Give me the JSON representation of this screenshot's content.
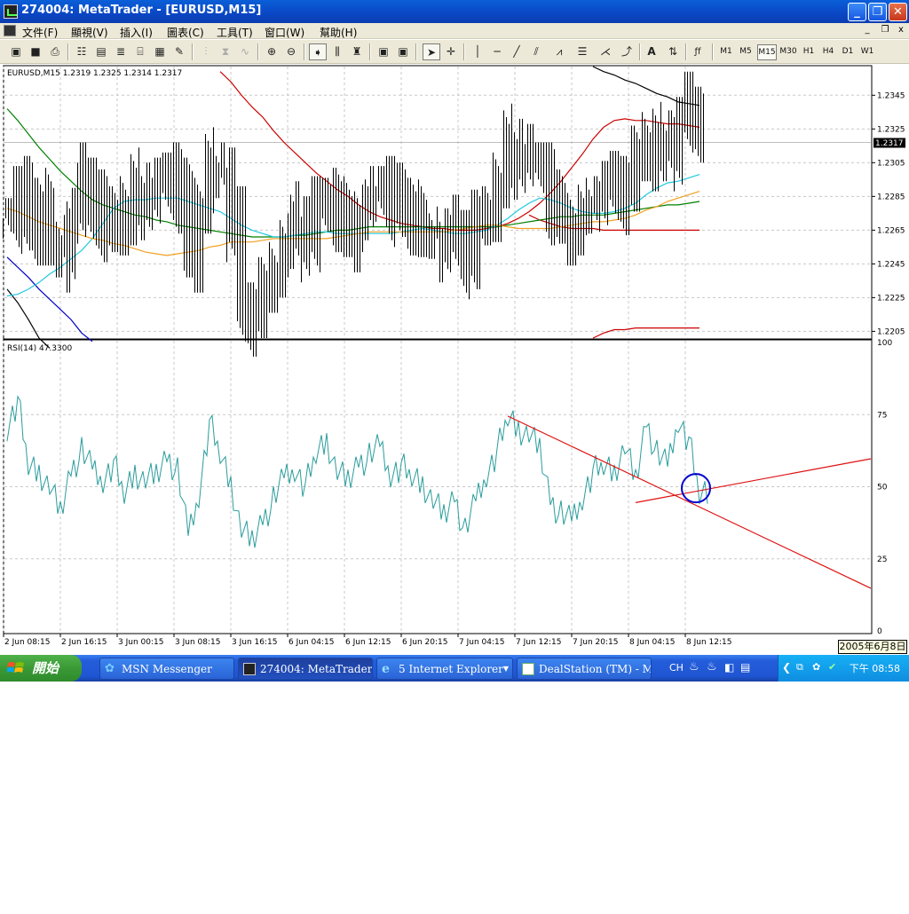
{
  "window": {
    "title": "274004: MetaTrader - [EURUSD,M15]",
    "minimize_glyph": "_",
    "restore_glyph": "❐",
    "close_glyph": "✕"
  },
  "menu": {
    "items": [
      "文件(F)",
      "顯視(V)",
      "插入(I)",
      "圖表(C)",
      "工具(T)",
      "窗口(W)",
      "幫助(H)"
    ],
    "mdi_min": "_",
    "mdi_restore": "❐",
    "mdi_close": "x"
  },
  "toolbar": {
    "timeframes": [
      "M1",
      "M5",
      "M15",
      "M30",
      "H1",
      "H4",
      "D1",
      "W1"
    ],
    "active_timeframe": "M15",
    "text_tool": "A",
    "fib_tool": "ƒf"
  },
  "chart_data": {
    "type": "line",
    "symbol_label": "EURUSD,M15  1.2319 1.2325 1.2314 1.2317",
    "price_ticks": [
      "1.2345",
      "1.2325",
      "1.2305",
      "1.2285",
      "1.2265",
      "1.2245",
      "1.2225",
      "1.2205"
    ],
    "price_range": [
      1.2201,
      1.2362
    ],
    "current_price": "1.2317",
    "time_ticks": [
      "2 Jun 08:15",
      "2 Jun 16:15",
      "3 Jun 00:15",
      "3 Jun 08:15",
      "3 Jun 16:15",
      "6 Jun 04:15",
      "6 Jun 12:15",
      "6 Jun 20:15",
      "7 Jun 04:15",
      "7 Jun 12:15",
      "7 Jun 20:15",
      "8 Jun 04:15",
      "8 Jun 12:15"
    ],
    "price_close_series": [
      1.2272,
      1.2285,
      1.2268,
      1.2281,
      1.2262,
      1.2249,
      1.2272,
      1.2293,
      1.228,
      1.2264,
      1.2279,
      1.2271,
      1.229,
      1.2283,
      1.2287,
      1.2299,
      1.2284,
      1.2252,
      1.2281,
      1.2305,
      1.2296,
      1.2267,
      1.2214,
      1.2219,
      1.2228,
      1.2246,
      1.2257,
      1.227,
      1.2258,
      1.2276,
      1.2284,
      1.2273,
      1.2264,
      1.2277,
      1.2282,
      1.2291,
      1.2276,
      1.2281,
      1.2274,
      1.2267,
      1.226,
      1.2255,
      1.2262,
      1.2248,
      1.2268,
      1.2279,
      1.2293,
      1.2316,
      1.2307,
      1.2305,
      1.2299,
      1.2277,
      1.2272,
      1.2268,
      1.2275,
      1.2285,
      1.2288,
      1.2286,
      1.2294,
      1.2306,
      1.2323,
      1.2309,
      1.2312,
      1.2329,
      1.2338,
      1.2317
    ],
    "overlays": [
      {
        "color": "#000000",
        "values": [
          1.223,
          1.2222,
          1.2212,
          1.2201,
          1.2195,
          null,
          null,
          null,
          null,
          null,
          null,
          null,
          null,
          null,
          null,
          null,
          null,
          null,
          null,
          null,
          null,
          null,
          null,
          null,
          null,
          null,
          null,
          null,
          null,
          null,
          null,
          null,
          null,
          null,
          null,
          null,
          null,
          null,
          null,
          null,
          null,
          null,
          null,
          null,
          null,
          null,
          null,
          null,
          null,
          null,
          null,
          null,
          null,
          null,
          null,
          1.2362,
          1.2359,
          1.2357,
          1.2354,
          1.2352,
          1.2349,
          1.2346,
          1.2344,
          1.2341,
          1.234,
          1.2339
        ]
      },
      {
        "color": "#0000c8",
        "values": [
          1.2249,
          1.2243,
          1.2237,
          1.223,
          1.2224,
          1.2218,
          1.2212,
          1.2204,
          1.2199,
          null,
          null,
          null,
          null,
          null,
          null,
          null,
          null,
          null,
          null,
          null,
          null,
          null,
          null,
          null,
          null,
          null,
          null,
          null,
          null,
          null,
          null,
          null,
          null,
          null,
          null,
          null,
          null,
          null,
          null,
          null,
          null,
          null,
          null,
          null,
          null,
          null,
          null,
          null,
          null,
          null,
          null,
          null,
          null,
          null,
          null,
          null,
          null,
          null,
          null,
          null,
          null,
          null,
          null,
          null,
          null,
          null
        ]
      },
      {
        "color": "#cc0000",
        "values": [
          null,
          null,
          null,
          null,
          null,
          null,
          null,
          null,
          null,
          null,
          null,
          null,
          null,
          null,
          null,
          null,
          null,
          null,
          null,
          null,
          1.2359,
          1.2353,
          1.2345,
          1.2338,
          1.2332,
          1.2324,
          1.2317,
          1.2311,
          1.2305,
          1.2299,
          1.2294,
          1.2289,
          1.2285,
          1.228,
          1.2276,
          1.2273,
          1.2271,
          1.2269,
          1.2268,
          1.2267,
          1.2266,
          1.2266,
          1.2265,
          1.2265,
          1.2265,
          1.2266,
          1.2267,
          1.2269,
          1.2272,
          1.2276,
          1.2281,
          1.2287,
          1.2294,
          1.2302,
          1.231,
          1.2319,
          1.2326,
          1.233,
          1.2331,
          1.233,
          1.233,
          1.2329,
          1.2328,
          1.2328,
          1.2327,
          1.2326
        ]
      },
      {
        "color": "#cc0000",
        "values": [
          null,
          null,
          null,
          null,
          null,
          null,
          null,
          null,
          null,
          null,
          null,
          null,
          null,
          null,
          null,
          null,
          null,
          null,
          null,
          null,
          null,
          null,
          null,
          null,
          null,
          null,
          null,
          null,
          null,
          null,
          null,
          null,
          null,
          null,
          null,
          null,
          null,
          null,
          null,
          null,
          null,
          null,
          null,
          null,
          null,
          null,
          null,
          null,
          null,
          null,
          null,
          null,
          null,
          null,
          null,
          1.2201,
          1.2204,
          1.2206,
          1.2206,
          1.2207,
          1.2207,
          1.2207,
          1.2207,
          1.2207,
          1.2207,
          1.2207
        ]
      },
      {
        "color": "#cc0000",
        "values": [
          null,
          null,
          null,
          null,
          null,
          null,
          null,
          null,
          null,
          null,
          null,
          null,
          null,
          null,
          null,
          null,
          null,
          null,
          null,
          null,
          null,
          null,
          null,
          null,
          null,
          null,
          null,
          null,
          null,
          null,
          null,
          null,
          null,
          null,
          null,
          null,
          null,
          null,
          null,
          null,
          null,
          null,
          null,
          null,
          null,
          null,
          null,
          null,
          null,
          1.2274,
          1.2271,
          1.2269,
          1.2267,
          1.2266,
          1.2266,
          1.2266,
          1.2265,
          1.2265,
          1.2265,
          1.2265,
          1.2265,
          1.2265,
          1.2265,
          1.2265,
          1.2265,
          1.2265
        ]
      },
      {
        "color": "#008000",
        "values": [
          1.2337,
          1.233,
          1.2322,
          1.2314,
          1.2307,
          1.23,
          1.2294,
          1.2288,
          1.2283,
          1.228,
          1.2278,
          1.2276,
          1.2274,
          1.2273,
          1.2271,
          1.227,
          1.2268,
          1.2267,
          1.2266,
          1.2265,
          1.2264,
          1.2263,
          1.2262,
          1.2261,
          1.2261,
          1.2261,
          1.2261,
          1.2262,
          1.2262,
          1.2263,
          1.2264,
          1.2265,
          1.2265,
          1.2266,
          1.2267,
          1.2267,
          1.2267,
          1.2267,
          1.2267,
          1.2267,
          1.2267,
          1.2267,
          1.2267,
          1.2267,
          1.2267,
          1.2267,
          1.2267,
          1.2268,
          1.2269,
          1.227,
          1.2271,
          1.2272,
          1.2273,
          1.2273,
          1.2274,
          1.2274,
          1.2274,
          1.2275,
          1.2276,
          1.2277,
          1.2278,
          1.2279,
          1.228,
          1.228,
          1.2281,
          1.2282
        ]
      },
      {
        "color": "#20c8e0",
        "values": [
          1.2226,
          1.2227,
          1.223,
          1.2234,
          1.2239,
          1.2243,
          1.2248,
          1.2253,
          1.226,
          1.2269,
          1.2278,
          1.2282,
          1.2283,
          1.2283,
          1.2284,
          1.2284,
          1.2284,
          1.2282,
          1.228,
          1.2278,
          1.2276,
          1.2272,
          1.2268,
          1.2265,
          1.2263,
          1.2261,
          1.2261,
          1.2262,
          1.2263,
          1.2264,
          1.2264,
          1.2263,
          1.2263,
          1.2263,
          1.2263,
          1.2263,
          1.2263,
          1.2264,
          1.2265,
          1.2266,
          1.2265,
          1.2264,
          1.2263,
          1.2263,
          1.2264,
          1.2265,
          1.2268,
          1.2272,
          1.2277,
          1.2281,
          1.2284,
          1.2283,
          1.2281,
          1.2278,
          1.2276,
          1.2275,
          1.2275,
          1.2276,
          1.2278,
          1.2281,
          1.2286,
          1.229,
          1.2293,
          1.2294,
          1.2296,
          1.2298
        ]
      },
      {
        "color": "#f0a020",
        "values": [
          1.2278,
          1.2276,
          1.2273,
          1.227,
          1.2268,
          1.2266,
          1.2264,
          1.2262,
          1.226,
          1.2259,
          1.2257,
          1.2256,
          1.2254,
          1.2252,
          1.2251,
          1.225,
          1.2251,
          1.2252,
          1.2253,
          1.2255,
          1.2256,
          1.2258,
          1.2258,
          1.2258,
          1.2259,
          1.226,
          1.226,
          1.226,
          1.226,
          1.226,
          1.226,
          1.2261,
          1.2262,
          1.2263,
          1.2264,
          1.2264,
          1.2264,
          1.2264,
          1.2264,
          1.2264,
          1.2264,
          1.2264,
          1.2265,
          1.2266,
          1.2267,
          1.2268,
          1.2268,
          1.2267,
          1.2266,
          1.2266,
          1.2266,
          1.2266,
          1.2267,
          1.2268,
          1.2269,
          1.227,
          1.227,
          1.2271,
          1.2272,
          1.2274,
          1.2277,
          1.2279,
          1.2282,
          1.2284,
          1.2286,
          1.2288
        ]
      }
    ],
    "rsi_label": "RSI(14)  47.3300",
    "rsi_ticks": [
      "100",
      "75",
      "50",
      "25",
      "0"
    ],
    "rsi_series": [
      71,
      80,
      58,
      55,
      50,
      41,
      55,
      62,
      56,
      53,
      58,
      48,
      55,
      52,
      54,
      60,
      55,
      33,
      48,
      72,
      62,
      51,
      35,
      31,
      38,
      45,
      53,
      57,
      50,
      62,
      66,
      55,
      52,
      58,
      60,
      64,
      55,
      57,
      54,
      51,
      45,
      40,
      46,
      34,
      45,
      55,
      62,
      75,
      70,
      68,
      63,
      45,
      40,
      38,
      47,
      55,
      58,
      55,
      64,
      52,
      72,
      61,
      57,
      74,
      66,
      48
    ],
    "rsi_trendlines": [
      {
        "from": [
          47,
          74.5
        ],
        "to": [
          95.5,
          14.8
        ]
      },
      {
        "from": [
          59,
          44.5
        ],
        "to": [
          95.5,
          59.7
        ]
      }
    ],
    "rsi_marker": {
      "x": 65,
      "y": 49.5
    },
    "tooltip_date": "2005年6月8日"
  },
  "taskbar": {
    "start_label": "開始",
    "tasks": [
      {
        "label": "MSN Messenger",
        "active": false
      },
      {
        "label": "274004: MetaTrader - ...",
        "active": true
      },
      {
        "label": "5 Internet Explorer",
        "active": false
      },
      {
        "label": "DealStation (TM) - M...",
        "active": false
      }
    ],
    "lang": "CH",
    "clock": "下午 08:58"
  }
}
